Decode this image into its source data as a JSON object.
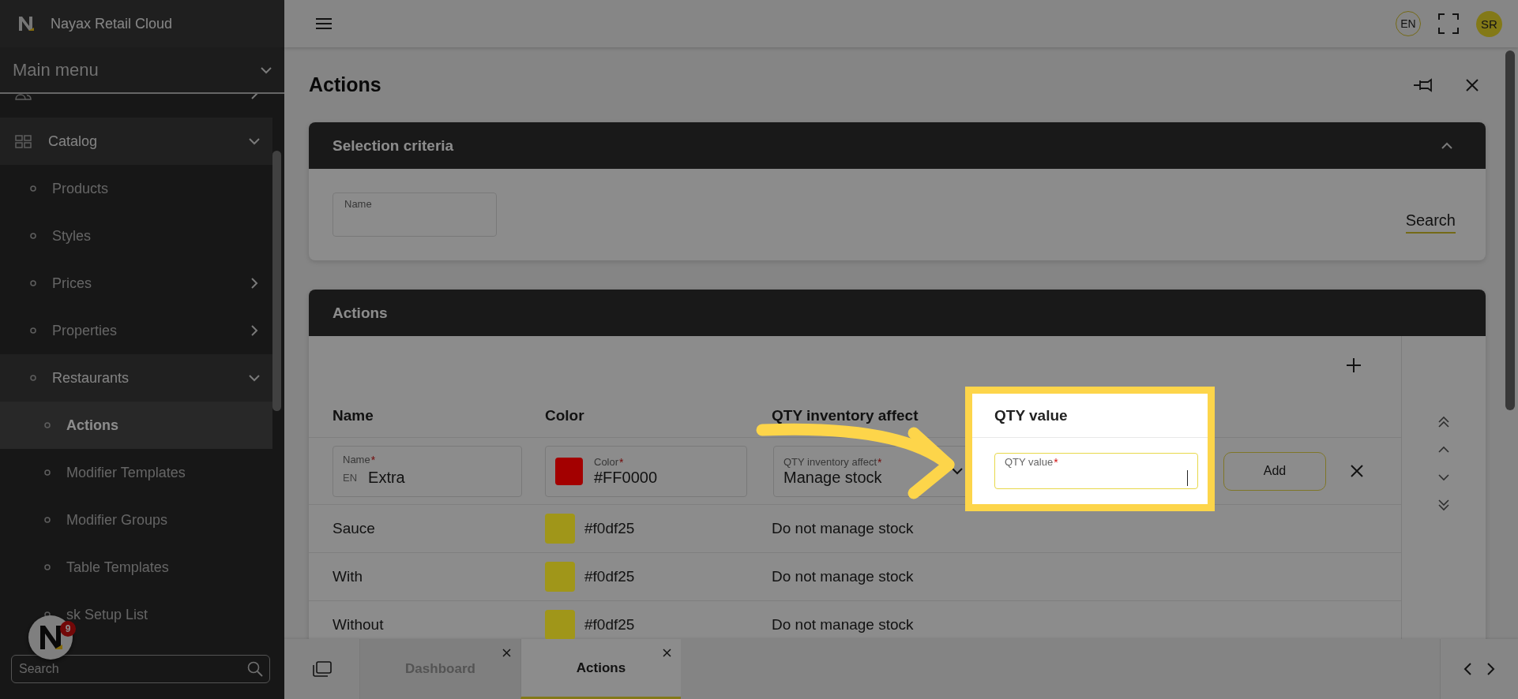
{
  "app": {
    "name": "Nayax Retail Cloud"
  },
  "sidebar": {
    "menu_title": "Main menu",
    "items": [
      {
        "expanded": false,
        "selected": false
      },
      {
        "label": "Catalog",
        "expanded": true,
        "selected": false,
        "children": [
          {
            "label": "Products",
            "selected": false
          },
          {
            "label": "Styles",
            "selected": false
          },
          {
            "label": "Prices",
            "expanded": false,
            "selected": false
          },
          {
            "label": "Properties",
            "expanded": false,
            "selected": false
          },
          {
            "label": "Restaurants",
            "expanded": true,
            "selected": false,
            "children": [
              {
                "label": "Actions",
                "selected": true
              },
              {
                "label": "Modifier Templates",
                "selected": false
              },
              {
                "label": "Modifier Groups",
                "selected": false
              },
              {
                "label": "Table Templates",
                "selected": false
              },
              {
                "label": "sk Setup List",
                "selected": false
              }
            ]
          }
        ]
      }
    ],
    "search": {
      "placeholder": "Search"
    },
    "assistant_badge": "9"
  },
  "topbar": {
    "language": "EN",
    "user_initials": "SR"
  },
  "page": {
    "title": "Actions",
    "selection_criteria": {
      "title": "Selection criteria",
      "expanded": true,
      "fields": [
        {
          "label": "Name"
        }
      ],
      "search_button": "Search"
    },
    "actions": {
      "title": "Actions",
      "columns": [
        {
          "label": "Name",
          "highlighted": false
        },
        {
          "label": "Color",
          "highlighted": false
        },
        {
          "label": "QTY inventory affect",
          "highlighted": false
        },
        {
          "label": "QTY value",
          "highlighted": true
        }
      ],
      "edit_row": {
        "name_field": {
          "label": "Name",
          "required_mark": "*",
          "prefix": "EN",
          "value": "Extra"
        },
        "color_field": {
          "label": "Color",
          "required_mark": "*",
          "value": "#FF0000",
          "color": "#a30000"
        },
        "inventory_field": {
          "label": "QTY inventory affect",
          "required_mark": "*",
          "value": "Manage stock"
        },
        "qty_field": {
          "label": "QTY value",
          "required_mark": "*",
          "focused": true
        },
        "add_button": "Add"
      },
      "rows": [
        {
          "name": "Sauce",
          "color_text": "#f0df25",
          "color": "#a09619",
          "inventory": "Do not manage stock"
        },
        {
          "name": "With",
          "color_text": "#f0df25",
          "color": "#a09619",
          "inventory": "Do not manage stock"
        },
        {
          "name": "Without",
          "color_text": "#f0df25",
          "color": "#a09619",
          "inventory": "Do not manage stock"
        }
      ]
    }
  },
  "tabs": [
    {
      "label": "Dashboard",
      "selected": false
    },
    {
      "label": "Actions",
      "selected": true
    }
  ]
}
